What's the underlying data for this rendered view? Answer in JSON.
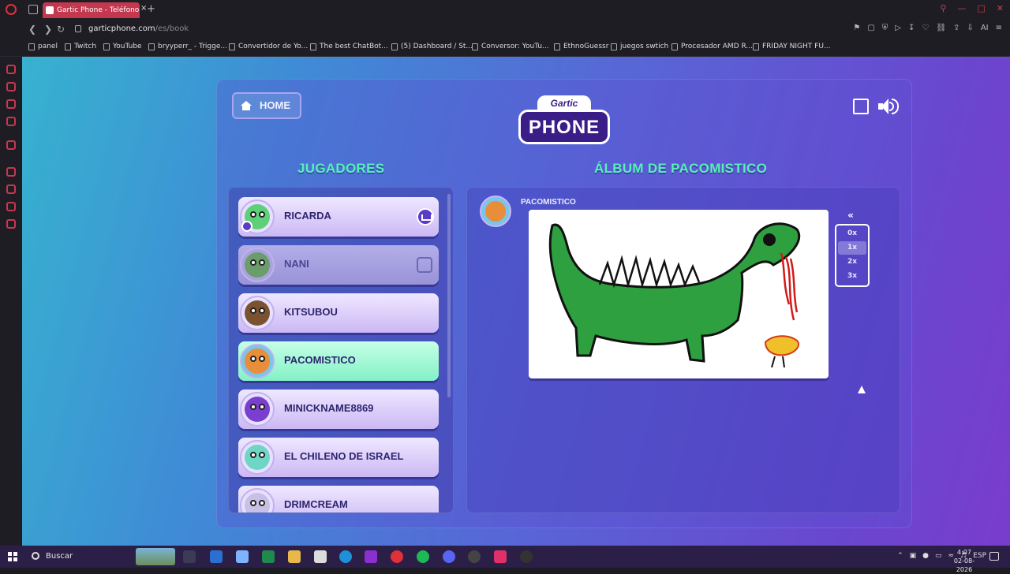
{
  "browser": {
    "tab_title": "Gartic Phone - Teléfono De",
    "tab_close": "×",
    "new_tab": "+",
    "url_host": "garticphone.com",
    "url_path": "/es/book",
    "bookmarks": [
      {
        "label": "panel"
      },
      {
        "label": "Twitch"
      },
      {
        "label": "YouTube"
      },
      {
        "label": "bryyperr_ - Trigge..."
      },
      {
        "label": "Convertidor de Yo..."
      },
      {
        "label": "The best ChatBot..."
      },
      {
        "label": "(5) Dashboard / St..."
      },
      {
        "label": "Conversor: YouTu..."
      },
      {
        "label": "EthnoGuessr"
      },
      {
        "label": "juegos swtich"
      },
      {
        "label": "Procesador AMD R..."
      },
      {
        "label": "FRIDAY NIGHT FU..."
      }
    ],
    "ai_label": "AI"
  },
  "game": {
    "home_label": "HOME",
    "logo_top": "Gartic",
    "logo_main": "PHONE",
    "players_title": "JUGADORES",
    "album_title": "ÁLBUM DE PACOMISTICO",
    "players": [
      {
        "name": "RICARDA",
        "state": "host",
        "color": "#5fd07a"
      },
      {
        "name": "NANI",
        "state": "left",
        "color": "#6b9c6b"
      },
      {
        "name": "KITSUBOU",
        "state": "normal",
        "color": "#7a5230"
      },
      {
        "name": "PACOMISTICO",
        "state": "active",
        "color": "#e88d3a"
      },
      {
        "name": "MINICKNAME8869",
        "state": "normal",
        "color": "#7a3fd0"
      },
      {
        "name": "EL CHILENO DE ISRAEL",
        "state": "normal",
        "color": "#6fd6c6"
      },
      {
        "name": "DRIMCREAM",
        "state": "normal",
        "color": "#c9c0e6"
      }
    ],
    "album_author": "PACOMISTICO",
    "speed_back": "«",
    "speeds": [
      "0x",
      "1x",
      "2x",
      "3x"
    ],
    "speed_selected": "1x",
    "accent": "#57f0b9"
  },
  "taskbar": {
    "search_label": "Buscar",
    "lang": "ESP",
    "time": "4:07",
    "date": "02-08-2026"
  }
}
